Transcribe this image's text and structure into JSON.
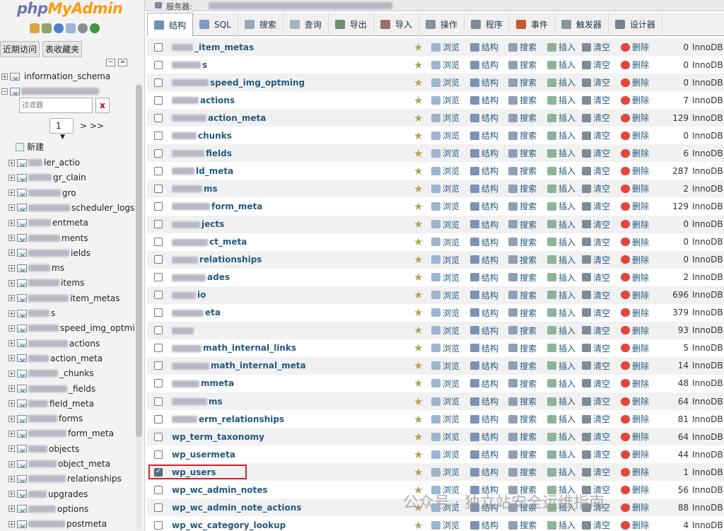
{
  "logo": {
    "php": "php",
    "my": "MyAdmin"
  },
  "nav": {
    "recent_label": "近期访问",
    "fav_label": "表收藏夹",
    "schema_label": "information_schema",
    "filter_placeholder": "过滤器",
    "filter_clear": "x",
    "page_value": "1",
    "page_nav": "> >>",
    "new_label": "新建",
    "tables": [
      "ler_actio",
      "gr_clain",
      "gro",
      "scheduler_logs",
      "entmeta",
      "ments",
      "ields",
      "ms",
      "items",
      "item_metas",
      "s",
      "speed_img_optmi",
      "actions",
      "action_meta",
      "_chunks",
      "_fields",
      "field_meta",
      "forms",
      "form_meta",
      "objects",
      "object_meta",
      "relationships",
      "upgrades",
      "options",
      "postmeta"
    ]
  },
  "topbar": {
    "server_label": "服务器:"
  },
  "tabs": [
    {
      "label": "结构",
      "icon": "structure-icon",
      "color": "#6f8fb5"
    },
    {
      "label": "SQL",
      "icon": "sql-icon",
      "color": "#7e9cc0"
    },
    {
      "label": "搜索",
      "icon": "search-icon",
      "color": "#9aa9b9"
    },
    {
      "label": "查询",
      "icon": "query-icon",
      "color": "#a8b3bf"
    },
    {
      "label": "导出",
      "icon": "export-icon",
      "color": "#6e8f6b"
    },
    {
      "label": "导入",
      "icon": "import-icon",
      "color": "#9a6f6f"
    },
    {
      "label": "操作",
      "icon": "wrench-icon",
      "color": "#8a8f99"
    },
    {
      "label": "程序",
      "icon": "routines-icon",
      "color": "#7f8a96"
    },
    {
      "label": "事件",
      "icon": "clock-icon",
      "color": "#c45a2d"
    },
    {
      "label": "触发器",
      "icon": "triggers-icon",
      "color": "#8b949e"
    },
    {
      "label": "设计器",
      "icon": "designer-icon",
      "color": "#77828f"
    }
  ],
  "actions": {
    "browse": "浏览",
    "structure": "结构",
    "search": "搜索",
    "insert": "插入",
    "empty": "清空",
    "drop": "删除"
  },
  "rows": [
    {
      "name": "_item_metas",
      "count": "0",
      "engine": "InnoDB"
    },
    {
      "name": "s",
      "count": "0",
      "engine": "InnoDB"
    },
    {
      "name": "speed_img_optming",
      "count": "0",
      "engine": "InnoDB"
    },
    {
      "name": "actions",
      "count": "7",
      "engine": "InnoDB"
    },
    {
      "name": "action_meta",
      "count": "129",
      "engine": "InnoDB"
    },
    {
      "name": "chunks",
      "count": "0",
      "engine": "InnoDB"
    },
    {
      "name": "fields",
      "count": "6",
      "engine": "InnoDB"
    },
    {
      "name": "ld_meta",
      "count": "287",
      "engine": "InnoDB"
    },
    {
      "name": "ms",
      "count": "2",
      "engine": "InnoDB"
    },
    {
      "name": "form_meta",
      "count": "129",
      "engine": "InnoDB"
    },
    {
      "name": "jects",
      "count": "0",
      "engine": "InnoDB"
    },
    {
      "name": "ct_meta",
      "count": "0",
      "engine": "InnoDB"
    },
    {
      "name": "relationships",
      "count": "0",
      "engine": "InnoDB"
    },
    {
      "name": "ades",
      "count": "2",
      "engine": "InnoDB"
    },
    {
      "name": "io",
      "count": "696",
      "engine": "InnoDB"
    },
    {
      "name": "eta",
      "count": "379",
      "engine": "InnoDB"
    },
    {
      "name": "",
      "count": "93",
      "engine": "InnoDB"
    },
    {
      "name": "math_internal_links",
      "count": "5",
      "engine": "InnoDB"
    },
    {
      "name": "math_internal_meta",
      "count": "14",
      "engine": "InnoDB"
    },
    {
      "name": "mmeta",
      "count": "48",
      "engine": "InnoDB"
    },
    {
      "name": "ms",
      "count": "64",
      "engine": "InnoDB"
    },
    {
      "name": "erm_relationships",
      "count": "81",
      "engine": "InnoDB"
    },
    {
      "name": "wp_term_taxonomy",
      "count": "64",
      "engine": "InnoDB"
    },
    {
      "name": "wp_usermeta",
      "count": "44",
      "engine": "InnoDB"
    },
    {
      "name": "wp_users",
      "count": "1",
      "engine": "InnoDB",
      "checked": true
    },
    {
      "name": "wp_wc_admin_notes",
      "count": "56",
      "engine": "InnoDB"
    },
    {
      "name": "wp_wc_admin_note_actions",
      "count": "88",
      "engine": "InnoDB"
    },
    {
      "name": "wp_wc_category_lookup",
      "count": "4",
      "engine": "InnoDB"
    }
  ],
  "watermark": "公众号 · 独立站安全运维指南"
}
